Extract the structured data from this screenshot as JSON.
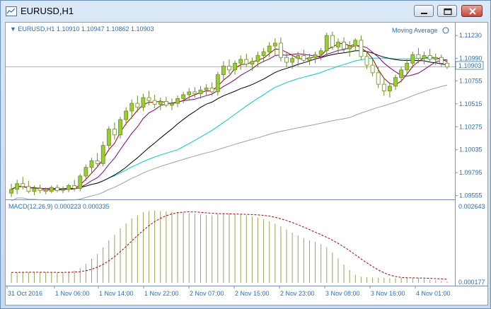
{
  "window": {
    "title": "EURUSD,H1"
  },
  "chart": {
    "header": "EURUSD,H1  1.10910 1.10947 1.10862 1.10903",
    "indicator_label": "Moving Average",
    "price_tag": "1.10903",
    "y_ticks": [
      "1.11230",
      "1.10990",
      "1.10755",
      "1.10515",
      "1.10275",
      "1.10035",
      "1.09795",
      "1.09555"
    ],
    "x_ticks": [
      "31 Oct 2016",
      "1 Nov 06:00",
      "1 Nov 14:00",
      "1 Nov 22:00",
      "2 Nov 07:00",
      "2 Nov 15:00",
      "2 Nov 23:00",
      "3 Nov 08:00",
      "3 Nov 16:00",
      "4 Nov 01:00"
    ]
  },
  "macd": {
    "header": "MACD(12,26,9) 0.000223 0.000335",
    "y_top": "0.002643",
    "y_bottom": "0.000177"
  },
  "colors": {
    "bull": "#9acd32",
    "bear": "#ffffff",
    "wick": "#6b8e23",
    "ma_fast": "#a00000",
    "ma_mid": "#800080",
    "ma_slow": "#000000",
    "ma_cyan": "#00cccc",
    "ma_long": "#a0a0a0",
    "macd_hist": "#9aa35a",
    "macd_signal": "#b00000"
  },
  "chart_data": {
    "type": "candlestick",
    "symbol": "EURUSD",
    "timeframe": "H1",
    "ylim": [
      1.0953,
      1.1132
    ],
    "candles": [
      {
        "o": 1.0958,
        "h": 1.0968,
        "l": 1.0954,
        "c": 1.0962
      },
      {
        "o": 1.0962,
        "h": 1.0972,
        "l": 1.0957,
        "c": 1.0968
      },
      {
        "o": 1.0968,
        "h": 1.0975,
        "l": 1.0962,
        "c": 1.0965
      },
      {
        "o": 1.0965,
        "h": 1.0971,
        "l": 1.0958,
        "c": 1.096
      },
      {
        "o": 1.096,
        "h": 1.0966,
        "l": 1.0956,
        "c": 1.0963
      },
      {
        "o": 1.0963,
        "h": 1.0967,
        "l": 1.0958,
        "c": 1.0961
      },
      {
        "o": 1.0961,
        "h": 1.0964,
        "l": 1.0957,
        "c": 1.096
      },
      {
        "o": 1.096,
        "h": 1.0966,
        "l": 1.0958,
        "c": 1.0964
      },
      {
        "o": 1.0964,
        "h": 1.0967,
        "l": 1.0959,
        "c": 1.0961
      },
      {
        "o": 1.0961,
        "h": 1.0965,
        "l": 1.0958,
        "c": 1.0962
      },
      {
        "o": 1.0962,
        "h": 1.0968,
        "l": 1.0959,
        "c": 1.0966
      },
      {
        "o": 1.0966,
        "h": 1.0972,
        "l": 1.096,
        "c": 1.0963
      },
      {
        "o": 1.0963,
        "h": 1.0978,
        "l": 1.096,
        "c": 1.0976
      },
      {
        "o": 1.0976,
        "h": 1.0988,
        "l": 1.0971,
        "c": 1.0985
      },
      {
        "o": 1.0985,
        "h": 1.0995,
        "l": 1.0979,
        "c": 1.0992
      },
      {
        "o": 1.0992,
        "h": 1.1,
        "l": 1.0985,
        "c": 1.0989
      },
      {
        "o": 1.0989,
        "h": 1.1012,
        "l": 1.0986,
        "c": 1.1008
      },
      {
        "o": 1.1008,
        "h": 1.1028,
        "l": 1.1002,
        "c": 1.1025
      },
      {
        "o": 1.1025,
        "h": 1.1032,
        "l": 1.1014,
        "c": 1.1019
      },
      {
        "o": 1.1019,
        "h": 1.1038,
        "l": 1.1015,
        "c": 1.1035
      },
      {
        "o": 1.1035,
        "h": 1.1048,
        "l": 1.1029,
        "c": 1.1044
      },
      {
        "o": 1.1044,
        "h": 1.1056,
        "l": 1.1036,
        "c": 1.1052
      },
      {
        "o": 1.1052,
        "h": 1.106,
        "l": 1.1043,
        "c": 1.1048
      },
      {
        "o": 1.1048,
        "h": 1.1062,
        "l": 1.1044,
        "c": 1.1058
      },
      {
        "o": 1.1058,
        "h": 1.1065,
        "l": 1.105,
        "c": 1.1055
      },
      {
        "o": 1.1055,
        "h": 1.1061,
        "l": 1.1047,
        "c": 1.1051
      },
      {
        "o": 1.1051,
        "h": 1.1058,
        "l": 1.1045,
        "c": 1.1054
      },
      {
        "o": 1.1054,
        "h": 1.1059,
        "l": 1.1048,
        "c": 1.105
      },
      {
        "o": 1.105,
        "h": 1.1057,
        "l": 1.1045,
        "c": 1.1052
      },
      {
        "o": 1.1052,
        "h": 1.106,
        "l": 1.1048,
        "c": 1.1057
      },
      {
        "o": 1.1057,
        "h": 1.1064,
        "l": 1.1052,
        "c": 1.1061
      },
      {
        "o": 1.1061,
        "h": 1.1068,
        "l": 1.1055,
        "c": 1.1064
      },
      {
        "o": 1.1064,
        "h": 1.1069,
        "l": 1.1058,
        "c": 1.1062
      },
      {
        "o": 1.1062,
        "h": 1.107,
        "l": 1.1057,
        "c": 1.1066
      },
      {
        "o": 1.1066,
        "h": 1.1072,
        "l": 1.106,
        "c": 1.1068
      },
      {
        "o": 1.1068,
        "h": 1.1074,
        "l": 1.106,
        "c": 1.1064
      },
      {
        "o": 1.1064,
        "h": 1.1085,
        "l": 1.106,
        "c": 1.1082
      },
      {
        "o": 1.1082,
        "h": 1.1096,
        "l": 1.1076,
        "c": 1.1091
      },
      {
        "o": 1.1091,
        "h": 1.1098,
        "l": 1.1083,
        "c": 1.1087
      },
      {
        "o": 1.1087,
        "h": 1.1097,
        "l": 1.1082,
        "c": 1.1094
      },
      {
        "o": 1.1094,
        "h": 1.1102,
        "l": 1.1087,
        "c": 1.1098
      },
      {
        "o": 1.1098,
        "h": 1.1104,
        "l": 1.109,
        "c": 1.1093
      },
      {
        "o": 1.1093,
        "h": 1.11,
        "l": 1.1086,
        "c": 1.1096
      },
      {
        "o": 1.1096,
        "h": 1.1106,
        "l": 1.109,
        "c": 1.1102
      },
      {
        "o": 1.1102,
        "h": 1.111,
        "l": 1.1095,
        "c": 1.1106
      },
      {
        "o": 1.1106,
        "h": 1.1116,
        "l": 1.11,
        "c": 1.1112
      },
      {
        "o": 1.1112,
        "h": 1.112,
        "l": 1.1102,
        "c": 1.1115
      },
      {
        "o": 1.1115,
        "h": 1.1121,
        "l": 1.1096,
        "c": 1.11
      },
      {
        "o": 1.11,
        "h": 1.1106,
        "l": 1.109,
        "c": 1.1095
      },
      {
        "o": 1.1095,
        "h": 1.1103,
        "l": 1.1088,
        "c": 1.1099
      },
      {
        "o": 1.1099,
        "h": 1.1106,
        "l": 1.1091,
        "c": 1.1102
      },
      {
        "o": 1.1102,
        "h": 1.1108,
        "l": 1.1094,
        "c": 1.1097
      },
      {
        "o": 1.1097,
        "h": 1.1104,
        "l": 1.1092,
        "c": 1.11
      },
      {
        "o": 1.11,
        "h": 1.1106,
        "l": 1.1094,
        "c": 1.1103
      },
      {
        "o": 1.1103,
        "h": 1.111,
        "l": 1.1097,
        "c": 1.1107
      },
      {
        "o": 1.1107,
        "h": 1.1126,
        "l": 1.1102,
        "c": 1.1123
      },
      {
        "o": 1.1123,
        "h": 1.1127,
        "l": 1.1108,
        "c": 1.1111
      },
      {
        "o": 1.1111,
        "h": 1.112,
        "l": 1.1104,
        "c": 1.1116
      },
      {
        "o": 1.1116,
        "h": 1.1121,
        "l": 1.1105,
        "c": 1.1109
      },
      {
        "o": 1.1109,
        "h": 1.1117,
        "l": 1.1101,
        "c": 1.1112
      },
      {
        "o": 1.1112,
        "h": 1.112,
        "l": 1.1106,
        "c": 1.1118
      },
      {
        "o": 1.1118,
        "h": 1.1123,
        "l": 1.1098,
        "c": 1.1101
      },
      {
        "o": 1.1101,
        "h": 1.1106,
        "l": 1.1088,
        "c": 1.1092
      },
      {
        "o": 1.1092,
        "h": 1.1098,
        "l": 1.108,
        "c": 1.1084
      },
      {
        "o": 1.1084,
        "h": 1.109,
        "l": 1.1068,
        "c": 1.1072
      },
      {
        "o": 1.1072,
        "h": 1.1079,
        "l": 1.106,
        "c": 1.1065
      },
      {
        "o": 1.1065,
        "h": 1.1074,
        "l": 1.1058,
        "c": 1.107
      },
      {
        "o": 1.107,
        "h": 1.1082,
        "l": 1.1066,
        "c": 1.1079
      },
      {
        "o": 1.1079,
        "h": 1.109,
        "l": 1.1074,
        "c": 1.1087
      },
      {
        "o": 1.1087,
        "h": 1.1098,
        "l": 1.1082,
        "c": 1.1094
      },
      {
        "o": 1.1094,
        "h": 1.1106,
        "l": 1.1089,
        "c": 1.1103
      },
      {
        "o": 1.1103,
        "h": 1.111,
        "l": 1.1094,
        "c": 1.1099
      },
      {
        "o": 1.1099,
        "h": 1.1106,
        "l": 1.1093,
        "c": 1.1102
      },
      {
        "o": 1.1102,
        "h": 1.1109,
        "l": 1.1095,
        "c": 1.1098
      },
      {
        "o": 1.1098,
        "h": 1.1104,
        "l": 1.1092,
        "c": 1.11
      },
      {
        "o": 1.11,
        "h": 1.1103,
        "l": 1.109,
        "c": 1.1094
      },
      {
        "o": 1.1094,
        "h": 1.1098,
        "l": 1.1088,
        "c": 1.109
      }
    ],
    "macd_hist": [
      0.00052,
      0.00052,
      0.00053,
      0.00053,
      0.00053,
      0.00052,
      0.00052,
      0.00051,
      0.00051,
      0.00052,
      0.00055,
      0.00058,
      0.00066,
      0.0008,
      0.00097,
      0.00113,
      0.00134,
      0.00158,
      0.00175,
      0.00197,
      0.00214,
      0.0023,
      0.0024,
      0.0025,
      0.00254,
      0.00255,
      0.00254,
      0.00253,
      0.00251,
      0.0025,
      0.00249,
      0.00247,
      0.00245,
      0.00243,
      0.00241,
      0.0024,
      0.00244,
      0.00247,
      0.00246,
      0.00244,
      0.00243,
      0.0024,
      0.00236,
      0.00232,
      0.00227,
      0.0022,
      0.00212,
      0.00203,
      0.00193,
      0.00183,
      0.00174,
      0.00165,
      0.00158,
      0.00152,
      0.00145,
      0.00135,
      0.00118,
      0.00098,
      0.00078,
      0.0006,
      0.00044,
      0.00038,
      0.00036,
      0.00035,
      0.00034,
      0.00034,
      0.00033,
      0.00033,
      0.00034,
      0.00034,
      0.00034,
      0.00033,
      0.0003,
      0.00028,
      0.00026,
      0.00024,
      0.00022
    ],
    "macd_signal_range": [
      0.000177,
      0.002643
    ]
  }
}
